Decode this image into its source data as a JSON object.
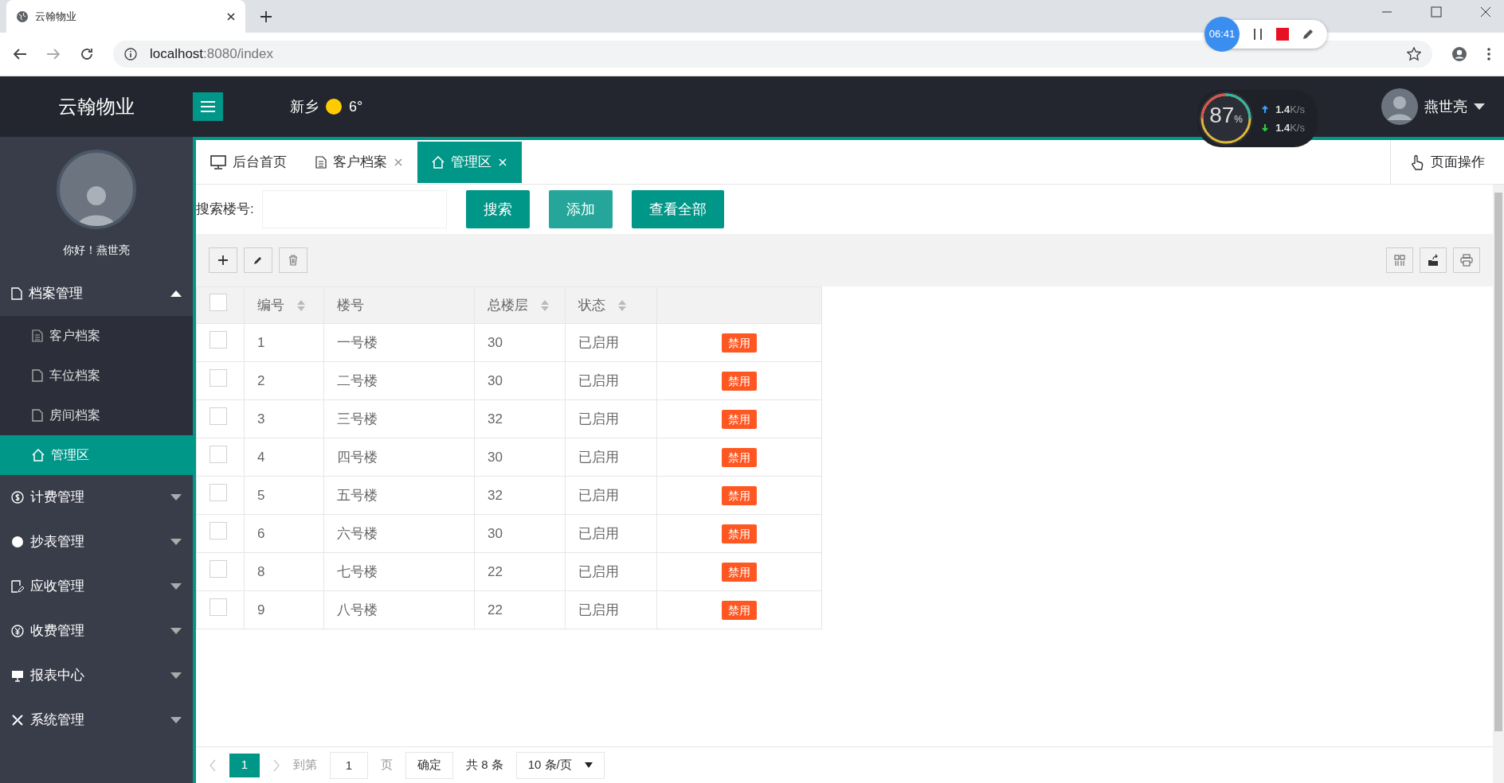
{
  "browser": {
    "tab_title": "云翰物业",
    "url_host": "localhost",
    "url_rest": ":8080/index",
    "recorder_time": "06:41"
  },
  "header": {
    "logo": "云翰物业",
    "city": "新乡",
    "temperature": "6°",
    "monitor": {
      "percent": "87",
      "unit": "%",
      "up": "1.4",
      "up_unit": "K/s",
      "down": "1.4",
      "down_unit": "K/s"
    },
    "user": "燕世亮"
  },
  "sidebar": {
    "greeting": "你好！燕世亮",
    "menu": [
      {
        "label": "档案管理",
        "expanded": true,
        "children": [
          {
            "label": "客户档案",
            "selected": false
          },
          {
            "label": "车位档案",
            "selected": false
          },
          {
            "label": "房间档案",
            "selected": false
          },
          {
            "label": "管理区",
            "selected": true
          }
        ]
      },
      {
        "label": "计费管理",
        "expanded": false
      },
      {
        "label": "抄表管理",
        "expanded": false
      },
      {
        "label": "应收管理",
        "expanded": false
      },
      {
        "label": "收费管理",
        "expanded": false
      },
      {
        "label": "报表中心",
        "expanded": false
      },
      {
        "label": "系统管理",
        "expanded": false
      }
    ]
  },
  "tabs": [
    {
      "label": "后台首页",
      "closable": false,
      "selected": false
    },
    {
      "label": "客户档案",
      "closable": true,
      "selected": false
    },
    {
      "label": "管理区",
      "closable": true,
      "selected": true
    }
  ],
  "page_operations": "页面操作",
  "search": {
    "label": "搜索楼号:",
    "buttons": [
      "搜索",
      "添加",
      "查看全部"
    ]
  },
  "table": {
    "all_checked": false,
    "columns": [
      {
        "label": "编号",
        "sortable": true
      },
      {
        "label": "楼号",
        "sortable": false
      },
      {
        "label": "总楼层",
        "sortable": true
      },
      {
        "label": "状态",
        "sortable": true
      }
    ],
    "rows": [
      {
        "checked": false,
        "cells": [
          "1",
          "一号楼",
          "30",
          "已启用"
        ],
        "action": "禁用"
      },
      {
        "checked": false,
        "cells": [
          "2",
          "二号楼",
          "30",
          "已启用"
        ],
        "action": "禁用"
      },
      {
        "checked": false,
        "cells": [
          "3",
          "三号楼",
          "32",
          "已启用"
        ],
        "action": "禁用"
      },
      {
        "checked": false,
        "cells": [
          "4",
          "四号楼",
          "30",
          "已启用"
        ],
        "action": "禁用"
      },
      {
        "checked": false,
        "cells": [
          "5",
          "五号楼",
          "32",
          "已启用"
        ],
        "action": "禁用"
      },
      {
        "checked": false,
        "cells": [
          "6",
          "六号楼",
          "30",
          "已启用"
        ],
        "action": "禁用"
      },
      {
        "checked": false,
        "cells": [
          "8",
          "七号楼",
          "22",
          "已启用"
        ],
        "action": "禁用"
      },
      {
        "checked": false,
        "cells": [
          "9",
          "八号楼",
          "22",
          "已启用"
        ],
        "action": "禁用"
      }
    ]
  },
  "pagination": {
    "current": "1",
    "goto": "到第",
    "page_value": "1",
    "page_unit": "页",
    "confirm": "确定",
    "total": "共 8 条",
    "page_size": "10 条/页"
  }
}
